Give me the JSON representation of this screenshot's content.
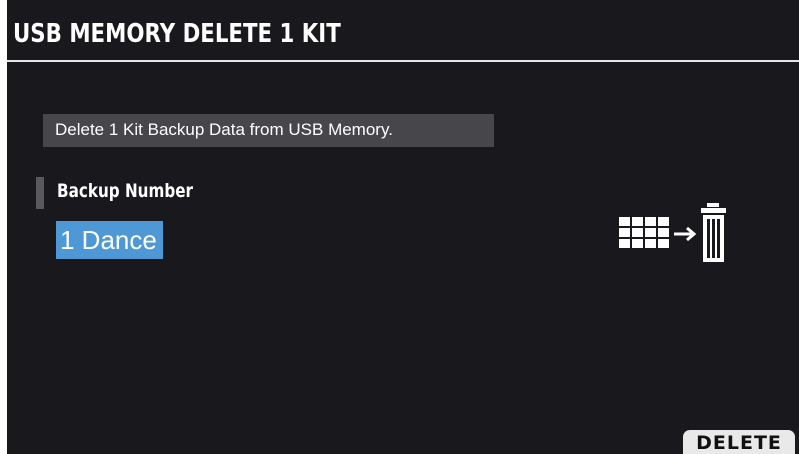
{
  "header": {
    "title": "USB MEMORY DELETE 1 KIT"
  },
  "message": {
    "text": "Delete 1 Kit Backup Data from USB Memory."
  },
  "parameter": {
    "label": "Backup Number",
    "value": "1 Dance"
  },
  "diagram": {
    "source_icon": "pad-grid-icon",
    "arrow_icon": "arrow-right-icon",
    "target_icon": "trash-can-icon"
  },
  "softkeys": {
    "delete_label": "DELETE"
  },
  "colors": {
    "background": "#19181c",
    "highlight": "#4f98d6",
    "message_box": "#47474b"
  }
}
